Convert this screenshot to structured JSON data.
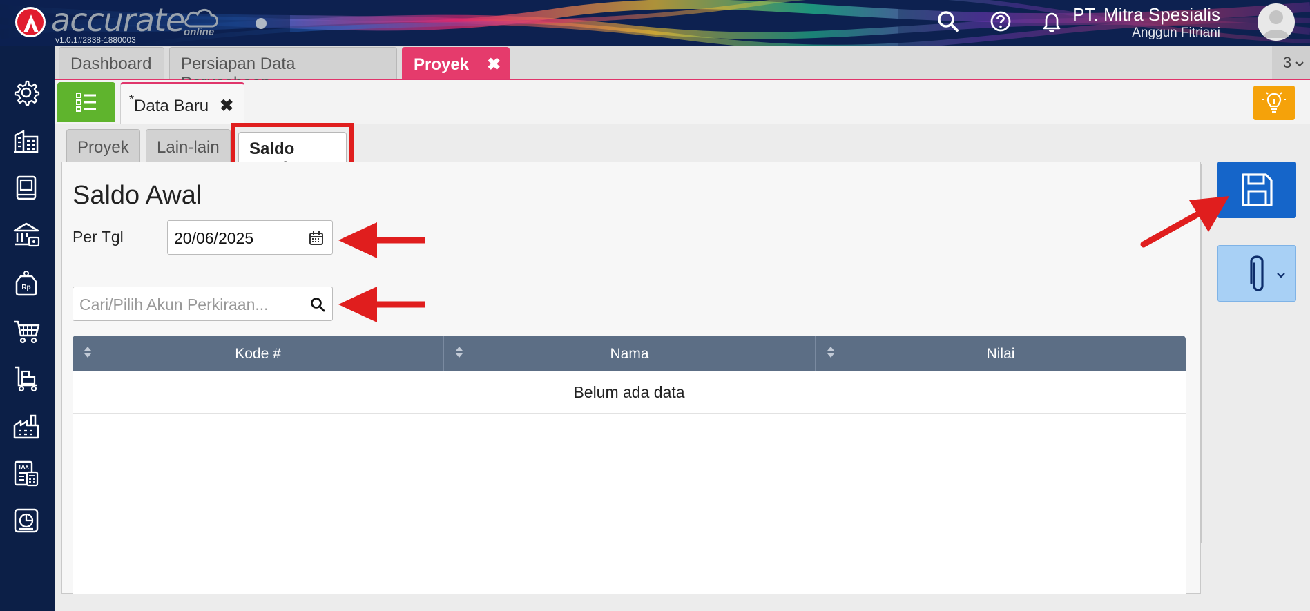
{
  "app": {
    "brand": "accurate",
    "brand_sub": "online",
    "version": "v1.0.1#2838-1880003"
  },
  "header": {
    "company": "PT. Mitra Spesialis",
    "user": "Anggun Fitriani",
    "icons": [
      "search-icon",
      "help-icon",
      "bell-icon",
      "avatar"
    ]
  },
  "sidebar": {
    "icons": [
      "gear-icon",
      "building-icon",
      "book-icon",
      "bank-icon",
      "price-tag-icon",
      "cart-icon",
      "pallet-cart-icon",
      "factory-icon",
      "tax-icon",
      "report-icon"
    ]
  },
  "main_tabs": [
    {
      "label": "Dashboard"
    },
    {
      "label": "Persiapan Data Perusahaan"
    },
    {
      "label": "Proyek",
      "close": "✖"
    }
  ],
  "tab_count": "3",
  "sub_tab": {
    "marker": "*",
    "label": "Data Baru",
    "close": "✖"
  },
  "section_tabs": [
    {
      "label": "Proyek"
    },
    {
      "label": "Lain-lain"
    },
    {
      "label": "Saldo Awal"
    }
  ],
  "form": {
    "title": "Saldo Awal",
    "date_label": "Per Tgl",
    "date_value": "20/06/2025",
    "search_placeholder": "Cari/Pilih Akun Perkiraan..."
  },
  "table": {
    "columns": [
      "Kode #",
      "Nama",
      "Nilai"
    ],
    "empty_text": "Belum ada data"
  },
  "colors": {
    "accent": "#e53b6c",
    "save": "#1565c9",
    "list_button": "#5fb42d",
    "bulb": "#f5a20a",
    "annotation": "#e01e1e"
  }
}
